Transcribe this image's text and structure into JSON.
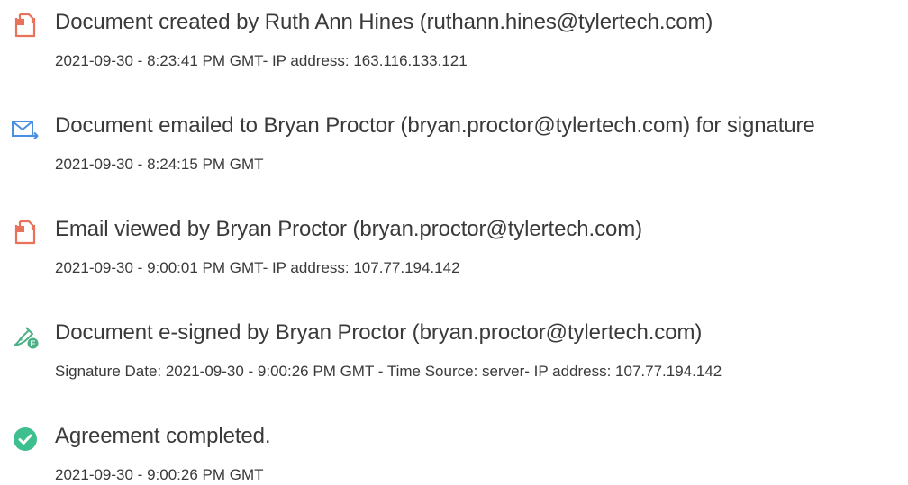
{
  "colors": {
    "doc_icon": "#e8725a",
    "email_icon": "#4a8fe0",
    "sign_icon": "#4caf86",
    "complete_icon": "#3dbf8f",
    "text": "#3a3a3a"
  },
  "events": [
    {
      "icon": "document-icon",
      "title": "Document created by Ruth Ann Hines (ruthann.hines@tylertech.com)",
      "detail": "2021-09-30 - 8:23:41 PM GMT- IP address: 163.116.133.121"
    },
    {
      "icon": "email-icon",
      "title": "Document emailed to Bryan Proctor (bryan.proctor@tylertech.com) for signature",
      "detail": "2021-09-30 - 8:24:15 PM GMT"
    },
    {
      "icon": "document-icon",
      "title": "Email viewed by Bryan Proctor (bryan.proctor@tylertech.com)",
      "detail": "2021-09-30 - 9:00:01 PM GMT- IP address: 107.77.194.142"
    },
    {
      "icon": "e-sign-icon",
      "title": "Document e-signed by Bryan Proctor (bryan.proctor@tylertech.com)",
      "detail": "Signature Date: 2021-09-30 - 9:00:26 PM GMT - Time Source: server- IP address: 107.77.194.142"
    },
    {
      "icon": "check-circle-icon",
      "title": "Agreement completed.",
      "detail": "2021-09-30 - 9:00:26 PM GMT"
    }
  ]
}
